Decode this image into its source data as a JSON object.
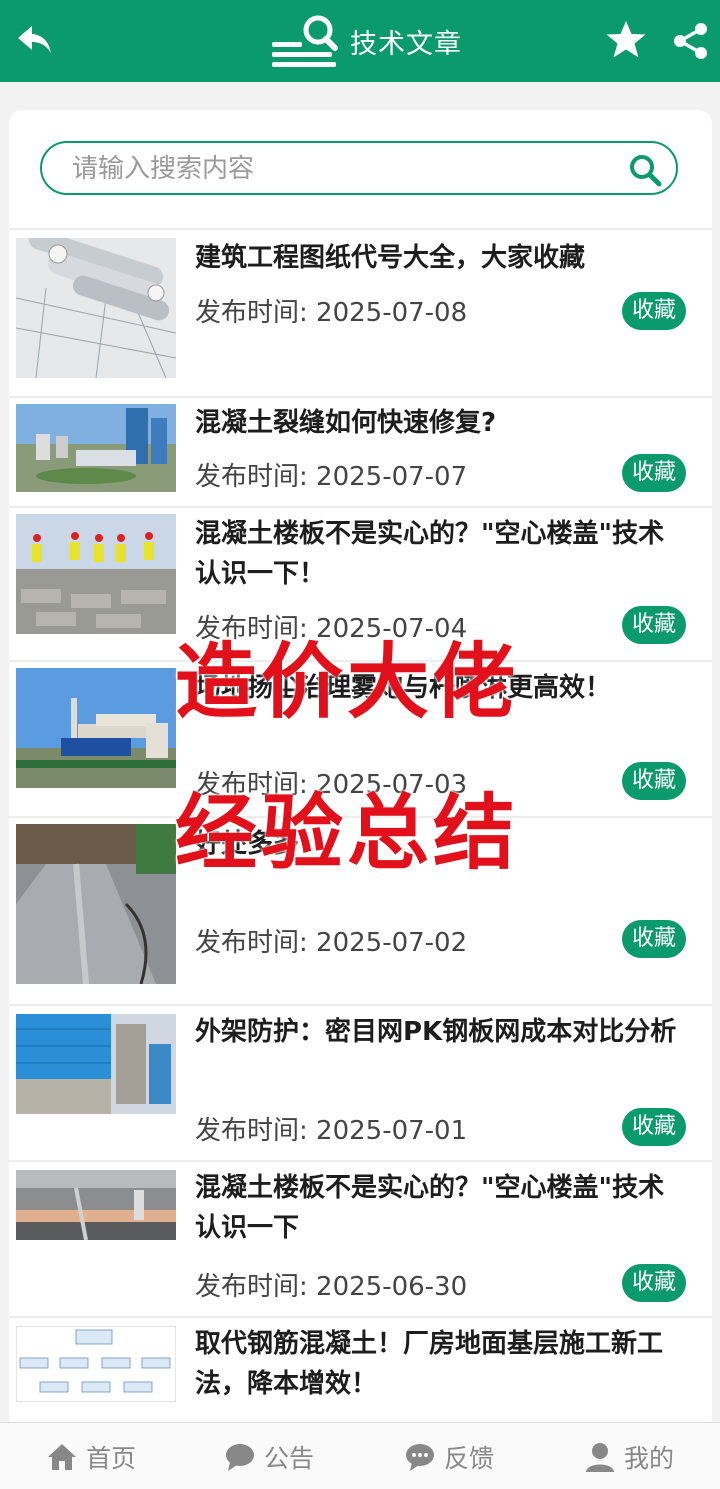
{
  "header": {
    "title": "技术文章"
  },
  "search": {
    "placeholder": "请输入搜索内容"
  },
  "articles": [
    {
      "title": "建筑工程图纸代号大全，大家收藏",
      "date": "发布时间: 2025-07-08",
      "fav": "收藏"
    },
    {
      "title": "混凝土裂缝如何快速修复?",
      "date": "发布时间: 2025-07-07",
      "fav": "收藏"
    },
    {
      "title": "混凝土楼板不是实心的？\"空心楼盖\"技术认识一下！",
      "date": "发布时间: 2025-07-04",
      "fav": "收藏"
    },
    {
      "title": "场地扬尘治理雾炮与杆喷淋更高效！",
      "date": "发布时间: 2025-07-03",
      "fav": "收藏"
    },
    {
      "title": "好处多多！",
      "date": "发布时间: 2025-07-02",
      "fav": "收藏"
    },
    {
      "title": "外架防护：密目网PK钢板网成本对比分析",
      "date": "发布时间: 2025-07-01",
      "fav": "收藏"
    },
    {
      "title": "混凝土楼板不是实心的？\"空心楼盖\"技术认识一下",
      "date": "发布时间: 2025-06-30",
      "fav": "收藏"
    },
    {
      "title": "取代钢筋混凝土！厂房地面基层施工新工法，降本增效！",
      "date": "",
      "fav": ""
    }
  ],
  "overlay": {
    "line1": "造价大佬",
    "line2": "经验总结"
  },
  "tabbar": {
    "home": "首页",
    "notice": "公告",
    "feedback": "反馈",
    "mine": "我的"
  },
  "colors": {
    "brand": "#0b9a6b",
    "overlay": "#e1101a"
  }
}
